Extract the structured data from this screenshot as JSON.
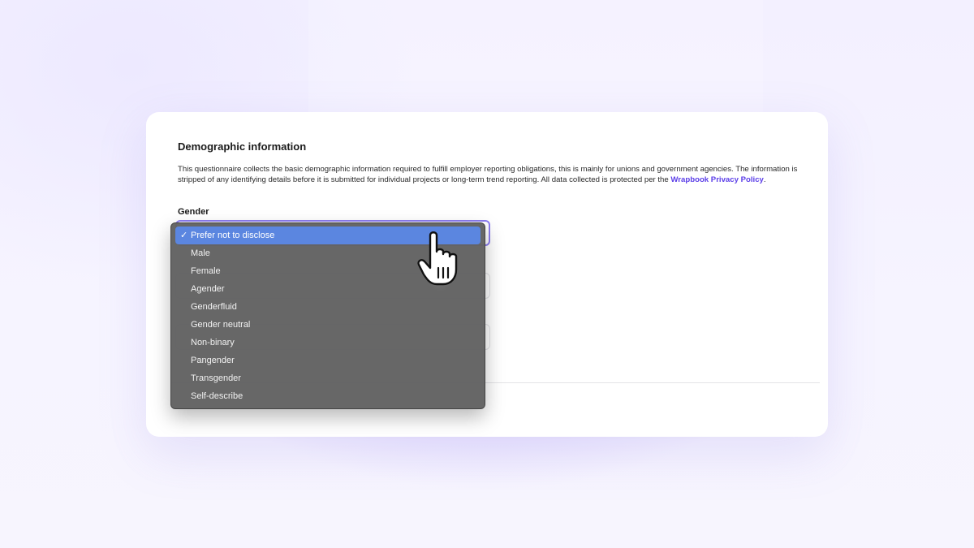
{
  "form": {
    "title": "Demographic information",
    "description": "This questionnaire collects the basic demographic information required to fulfill employer reporting obligations, this is mainly for unions and government agencies. The information is stripped of any identifying details before it is submitted for individual projects or long-term trend reporting. All data collected is protected per the ",
    "description_link": "Wrapbook Privacy Policy",
    "description_end": ".",
    "gender_label": "Gender",
    "gender_selected": "Prefer not to disclose"
  },
  "dropdown": {
    "check_icon": "checkmark-icon",
    "options": [
      {
        "label": "Prefer not to disclose",
        "selected": true
      },
      {
        "label": "Male",
        "selected": false
      },
      {
        "label": "Female",
        "selected": false
      },
      {
        "label": "Agender",
        "selected": false
      },
      {
        "label": "Genderfluid",
        "selected": false
      },
      {
        "label": "Gender neutral",
        "selected": false
      },
      {
        "label": "Non-binary",
        "selected": false
      },
      {
        "label": "Pangender",
        "selected": false
      },
      {
        "label": "Transgender",
        "selected": false
      },
      {
        "label": "Self-describe",
        "selected": false
      }
    ]
  },
  "colors": {
    "link": "#5b3ee8",
    "focus_border": "#8b7cf0",
    "highlight": "#5b86e0",
    "menu_bg": "#626262"
  },
  "cursor": {
    "icon": "pointing-hand-cursor-icon"
  }
}
